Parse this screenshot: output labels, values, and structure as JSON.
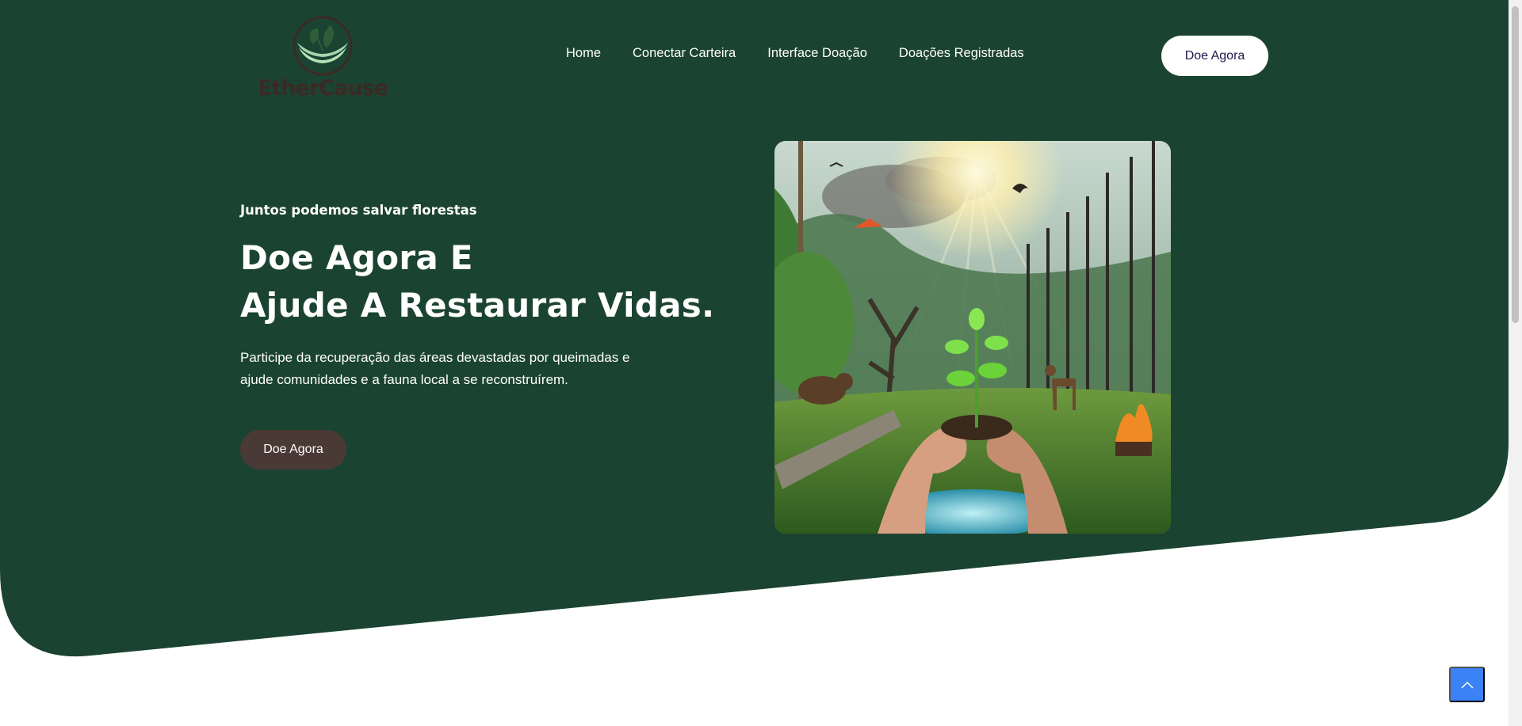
{
  "colors": {
    "hero_bg": "#1b4332",
    "header_cta_bg": "#ffffff",
    "header_cta_text": "#1c1a4a",
    "hero_cta_bg": "#4a3a36",
    "scroll_top_bg": "#3b82f6",
    "logo_text": "#3b2a24"
  },
  "header": {
    "logo_text": "EtherCause",
    "nav": [
      {
        "label": "Home"
      },
      {
        "label": "Conectar Carteira"
      },
      {
        "label": "Interface Doação"
      },
      {
        "label": "Doações Registradas"
      }
    ],
    "cta_label": "Doe Agora"
  },
  "hero": {
    "eyebrow": "Juntos podemos salvar florestas",
    "headline_line1": "Doe Agora E",
    "headline_line2": "Ajude A Restaurar Vidas.",
    "description": "Participe da recuperação das áreas devastadas por queimadas e ajude comunidades e a fauna local a se reconstruírem.",
    "cta_label": "Doe Agora",
    "image_icon": "forest-restoration-illustration"
  },
  "scroll_top": {
    "icon": "chevron-up-icon"
  }
}
